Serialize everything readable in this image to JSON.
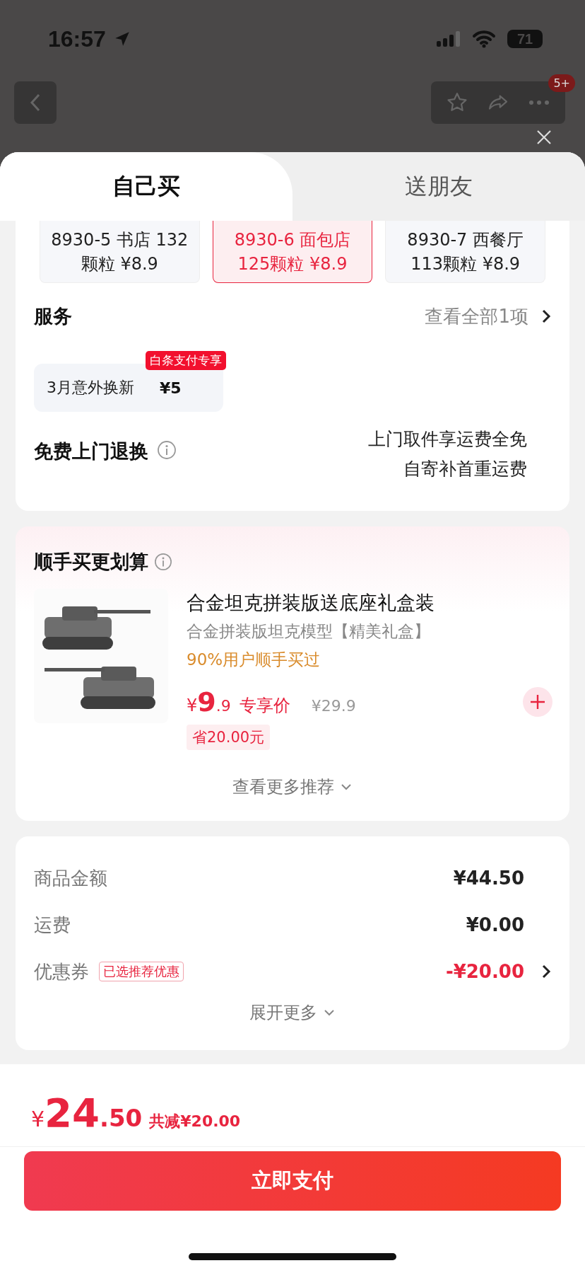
{
  "status_bar": {
    "time": "16:57",
    "battery": "71"
  },
  "nav": {
    "badge": "5+"
  },
  "tabs": [
    {
      "label": "自己买",
      "selected": true
    },
    {
      "label": "送朋友",
      "selected": false
    }
  ],
  "variants": [
    {
      "line1": "8930-5 书店 132",
      "line2": "颗粒  ¥8.9",
      "selected": false
    },
    {
      "line1": "8930-6 面包店",
      "line2": "125颗粒  ¥8.9",
      "selected": true
    },
    {
      "line1": "8930-7 西餐厅",
      "line2": "113颗粒  ¥8.9",
      "selected": false
    }
  ],
  "service": {
    "title": "服务",
    "link": "查看全部1项",
    "option": {
      "name": "3月意外换新",
      "price": "¥5",
      "tag": "白条支付专享"
    }
  },
  "free_return": {
    "title": "免费上门退换",
    "lines": [
      "上门取件享运费全免",
      "自寄补首重运费"
    ]
  },
  "addon": {
    "title": "顺手买更划算",
    "product": {
      "kind": "picture",
      "name": "合金坦克拼装版送底座礼盒装",
      "subtitle": "合金拼装版坦克模型【精美礼盒】",
      "social": "90%用户顺手买过",
      "currency": "¥",
      "price_int": "9",
      "price_dec": ".9",
      "price_label": "专享价",
      "original_price": "¥29.9",
      "saving": "省20.00元"
    },
    "more": "查看更多推荐"
  },
  "summary": [
    {
      "label": "商品金额",
      "value": "¥44.50",
      "kind": "plain"
    },
    {
      "label": "运费",
      "value": "¥0.00",
      "kind": "plain"
    },
    {
      "label": "优惠券",
      "tag": "已选推荐优惠",
      "value": "-¥20.00",
      "kind": "coupon"
    }
  ],
  "expand": "展开更多",
  "total": {
    "currency": "¥",
    "integer": "24",
    "decimal": ".50",
    "discount": "共减¥20.00"
  },
  "pay_button": "立即支付"
}
